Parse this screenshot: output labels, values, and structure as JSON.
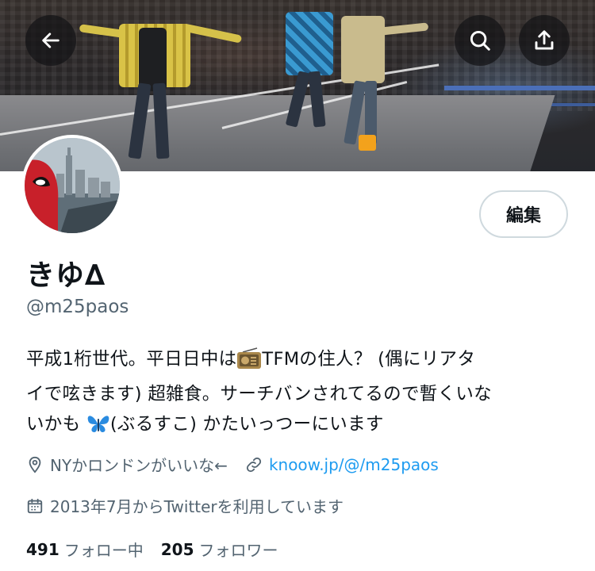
{
  "colors": {
    "text_primary": "#0f1419",
    "text_secondary": "#536471",
    "link": "#1d9bf0",
    "border": "#cfd9de",
    "overlay_button": "#141416"
  },
  "header": {
    "back_icon": "arrow-left-icon",
    "search_icon": "search-icon",
    "share_icon": "share-upload-icon"
  },
  "profile": {
    "edit_label": "編集",
    "display_name": "きゆ∆",
    "handle": "@m25paos",
    "bio": {
      "line1_before": "平成1桁世代。平日日中は",
      "line1_after": "TFMの住人？ (偶にリアタ",
      "line2": "イで呟きます) 超雑食。サーチバンされてるので暫くいな",
      "line3_before": "いかも ",
      "line3_after": "(ぶるすこ) かたいっつーにいます",
      "radio_emoji": "radio-icon",
      "butterfly_emoji": "butterfly-icon"
    },
    "location": "NYかロンドンがいいな←",
    "website": "knoow.jp/@/m25paos",
    "joined": "2013年7月からTwitterを利用しています",
    "following_count": "491",
    "following_label": "フォロー中",
    "followers_count": "205",
    "followers_label": "フォロワー"
  }
}
